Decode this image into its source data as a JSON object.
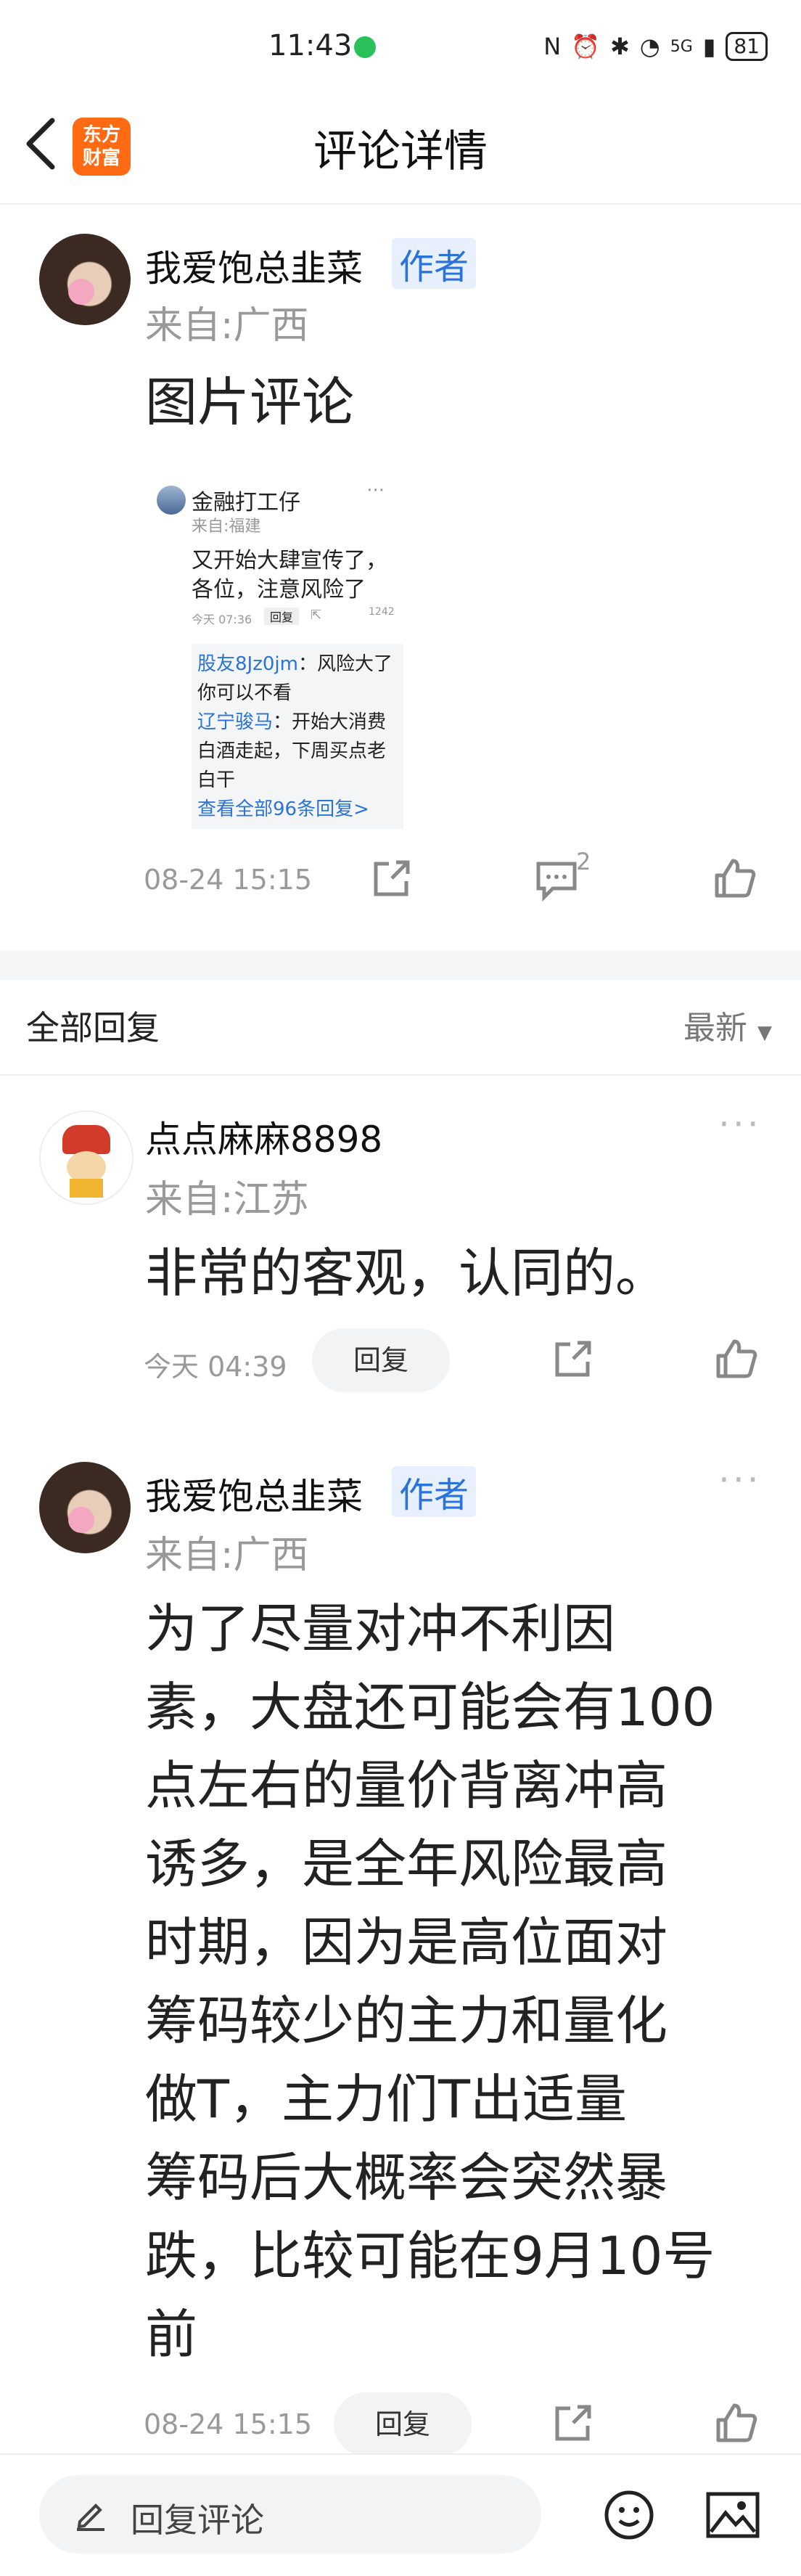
{
  "status_bar": {
    "time": "11:43",
    "network": "5G",
    "battery": "81"
  },
  "nav": {
    "title": "评论详情",
    "logo_line1": "东方",
    "logo_line2": "财富"
  },
  "main_comment": {
    "username": "我爱饱总韭菜",
    "author_tag": "作者",
    "location": "来自:广西",
    "text": "图片评论",
    "time": "08-24 15:15",
    "reply_count": "2",
    "embedded_image": {
      "username": "金融打工仔",
      "location": "来自:福建",
      "text_line1": "又开始大肆宣传了，",
      "text_line2": "各位，注意风险了",
      "time": "今天 07:36",
      "reply_label": "回复",
      "likes": "1242",
      "reply1_user": "股友8Jz0jm",
      "reply1_text": "：风险大了你可以不看",
      "reply2_user": "辽宁骏马",
      "reply2_text": "：开始大消费白酒走起，下周买点老白干",
      "view_all": "查看全部96条回复>"
    }
  },
  "replies_header": {
    "title": "全部回复",
    "sort": "最新"
  },
  "replies": [
    {
      "username": "点点麻麻8898",
      "location": "来自:江苏",
      "text": "非常的客观，认同的。",
      "time": "今天 04:39",
      "reply_label": "回复"
    },
    {
      "username": "我爱饱总韭菜",
      "author_tag": "作者",
      "location": "来自:广西",
      "text_lines": [
        "为了尽量对冲不利因",
        "素，大盘还可能会有100",
        "点左右的量价背离冲高",
        "诱多，是全年风险最高",
        "时期，因为是高位面对",
        "筹码较少的主力和量化",
        "做T，主力们T出适量",
        "筹码后大概率会突然暴",
        "跌，比较可能在9月10号",
        "前"
      ],
      "time": "08-24 15:15",
      "reply_label": "回复"
    }
  ],
  "bottom_bar": {
    "placeholder": "回复评论"
  }
}
